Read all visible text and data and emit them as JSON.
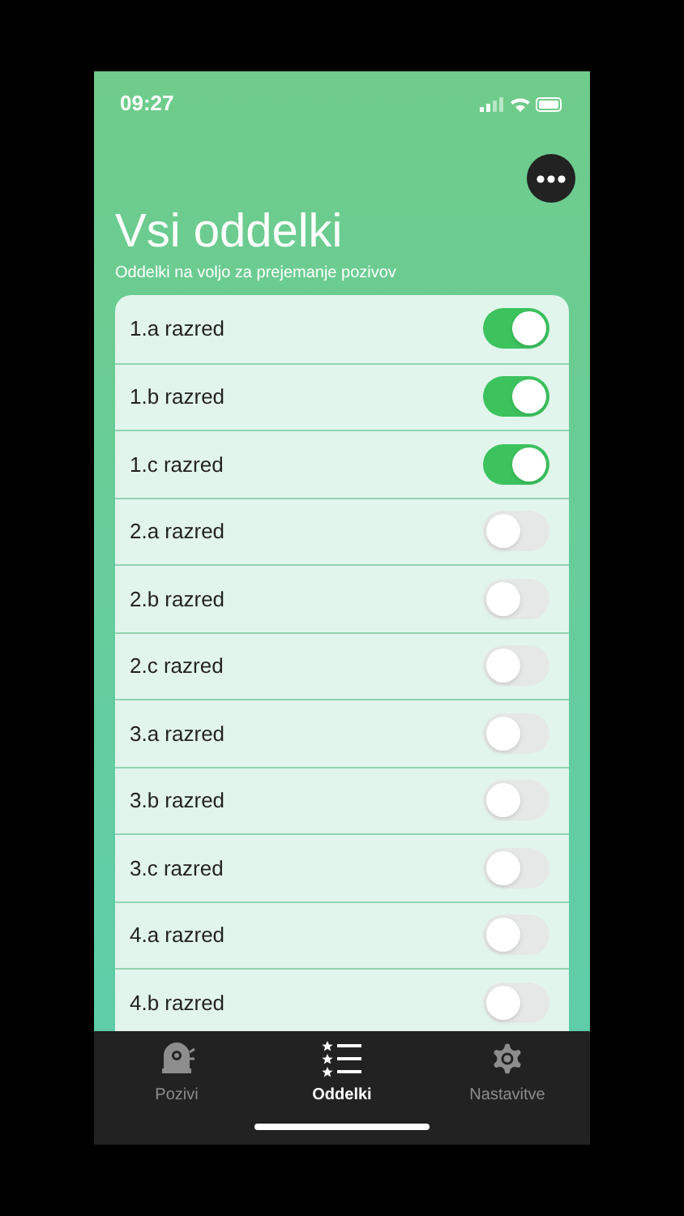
{
  "status_bar": {
    "time": "09:27"
  },
  "header": {
    "title": "Vsi oddelki",
    "subtitle": "Oddelki na voljo za prejemanje pozivov"
  },
  "classes": [
    {
      "label": "1.a razred",
      "on": true
    },
    {
      "label": "1.b razred",
      "on": true
    },
    {
      "label": "1.c razred",
      "on": true
    },
    {
      "label": "2.a razred",
      "on": false
    },
    {
      "label": "2.b razred",
      "on": false
    },
    {
      "label": "2.c razred",
      "on": false
    },
    {
      "label": "3.a razred",
      "on": false
    },
    {
      "label": "3.b razred",
      "on": false
    },
    {
      "label": "3.c razred",
      "on": false
    },
    {
      "label": "4.a razred",
      "on": false
    },
    {
      "label": "4.b razred",
      "on": false
    }
  ],
  "tab_bar": [
    {
      "label": "Pozivi",
      "kind": "bell",
      "selected": false
    },
    {
      "label": "Oddelki",
      "kind": "list",
      "selected": true
    },
    {
      "label": "Nastavitve",
      "kind": "gear",
      "selected": false
    }
  ]
}
